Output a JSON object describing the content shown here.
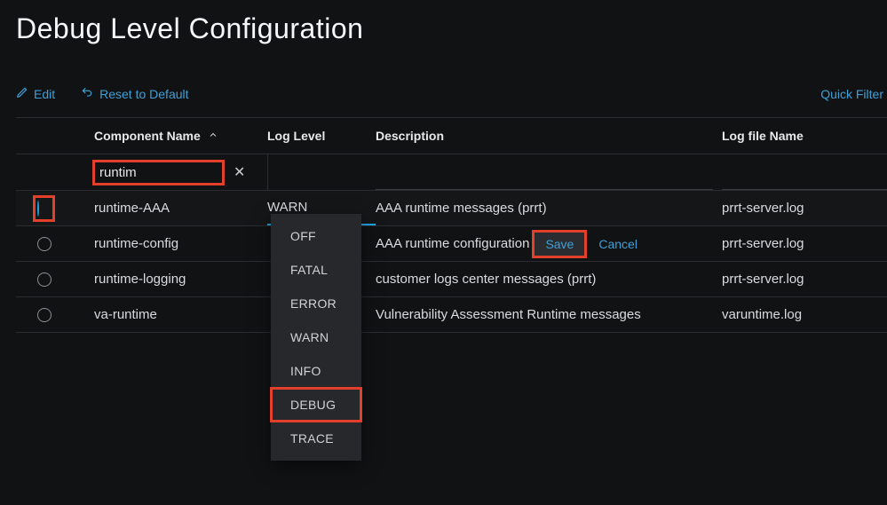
{
  "title": "Debug Level Configuration",
  "toolbar": {
    "edit": "Edit",
    "reset": "Reset to Default",
    "quick_filter": "Quick Filter"
  },
  "columns": {
    "component": "Component Name",
    "log_level": "Log Level",
    "description": "Description",
    "log_file": "Log file Name"
  },
  "filter": {
    "component_value": "runtim"
  },
  "actions": {
    "save": "Save",
    "cancel": "Cancel"
  },
  "log_levels": [
    "OFF",
    "FATAL",
    "ERROR",
    "WARN",
    "INFO",
    "DEBUG",
    "TRACE"
  ],
  "highlighted_level_index": 5,
  "rows": [
    {
      "selected": true,
      "component": "runtime-AAA",
      "log_level": "WARN",
      "description": "AAA runtime messages (prrt)",
      "log_file": "prrt-server.log",
      "editing": true
    },
    {
      "selected": false,
      "component": "runtime-config",
      "log_level": "",
      "description": "AAA runtime configuration",
      "log_file": "prrt-server.log",
      "editing": false
    },
    {
      "selected": false,
      "component": "runtime-logging",
      "log_level": "",
      "description": "customer logs center messages (prrt)",
      "log_file": "prrt-server.log",
      "editing": false
    },
    {
      "selected": false,
      "component": "va-runtime",
      "log_level": "",
      "description": "Vulnerability Assessment Runtime messages",
      "log_file": "varuntime.log",
      "editing": false
    }
  ]
}
